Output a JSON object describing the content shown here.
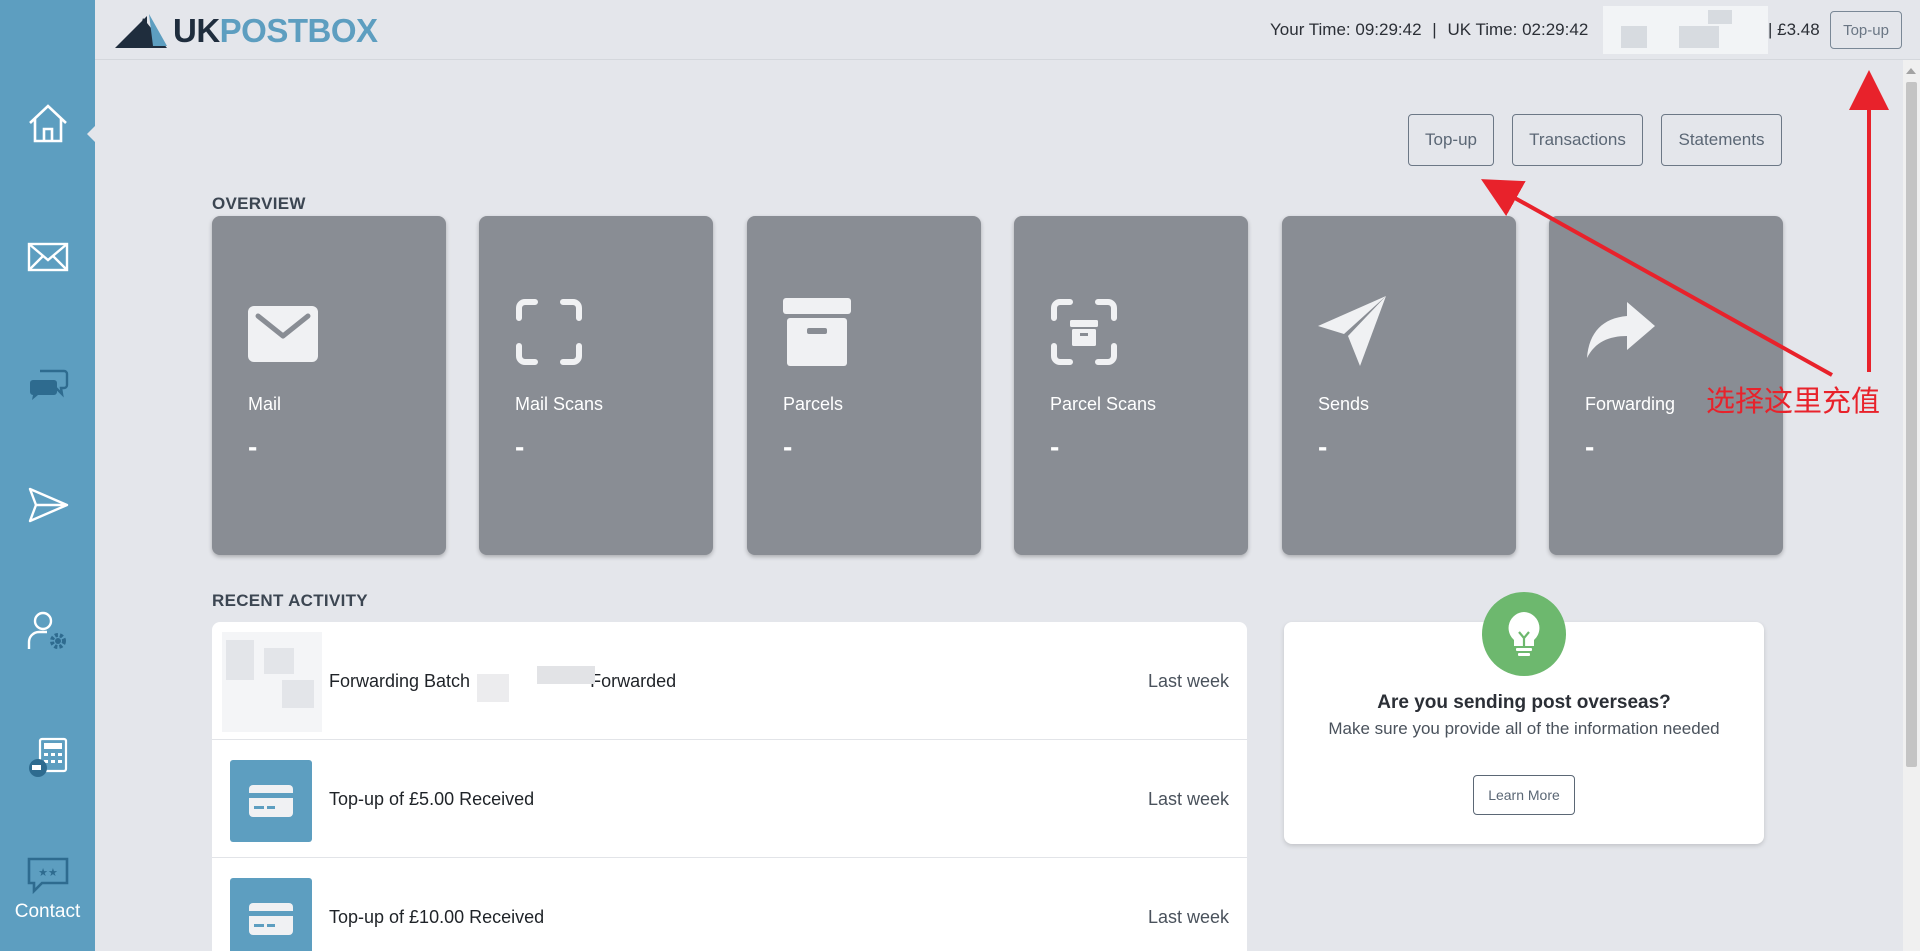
{
  "brand": {
    "name_part1": "UK",
    "name_part2": "POSTBOX"
  },
  "header": {
    "your_time_label": "Your Time:",
    "your_time": "09:29:42",
    "uk_time_label": "UK Time:",
    "uk_time": "02:29:42",
    "separator": "|",
    "balance": "| £3.48",
    "topup_label": "Top-up"
  },
  "sidebar": {
    "items": [
      {
        "icon": "home-icon"
      },
      {
        "icon": "mail-icon"
      },
      {
        "icon": "chat-icon"
      },
      {
        "icon": "send-icon"
      },
      {
        "icon": "user-settings-icon"
      },
      {
        "icon": "shipping-calculator-icon"
      }
    ],
    "contact_label": "Contact"
  },
  "actions": {
    "topup": "Top-up",
    "transactions": "Transactions",
    "statements": "Statements"
  },
  "overview": {
    "title": "OVERVIEW",
    "cards": [
      {
        "label": "Mail",
        "value": "-",
        "icon": "mail-icon"
      },
      {
        "label": "Mail Scans",
        "value": "-",
        "icon": "scan-icon"
      },
      {
        "label": "Parcels",
        "value": "-",
        "icon": "parcel-icon"
      },
      {
        "label": "Parcel Scans",
        "value": "-",
        "icon": "parcel-scan-icon"
      },
      {
        "label": "Sends",
        "value": "-",
        "icon": "paper-plane-icon"
      },
      {
        "label": "Forwarding",
        "value": "-",
        "icon": "forward-arrow-icon"
      }
    ]
  },
  "recent_activity": {
    "title": "RECENT ACTIVITY",
    "items": [
      {
        "text_a": "Forwarding Batch",
        "text_b": "Forwarded",
        "time": "Last week"
      },
      {
        "text": "Top-up of £5.00 Received",
        "time": "Last week",
        "icon": "credit-card-icon"
      },
      {
        "text": "Top-up of £10.00 Received",
        "time": "Last week",
        "icon": "credit-card-icon"
      }
    ]
  },
  "tip": {
    "title": "Are you sending post overseas?",
    "body": "Make sure you provide all of the information needed",
    "button": "Learn More",
    "icon": "lightbulb-icon"
  },
  "annotation": {
    "text": "选择这里充值",
    "color": "#e8222b"
  },
  "colors": {
    "sidebar": "#5d9ec0",
    "card": "#898d94",
    "background": "#e4e6eb",
    "bulb": "#6db86e"
  }
}
